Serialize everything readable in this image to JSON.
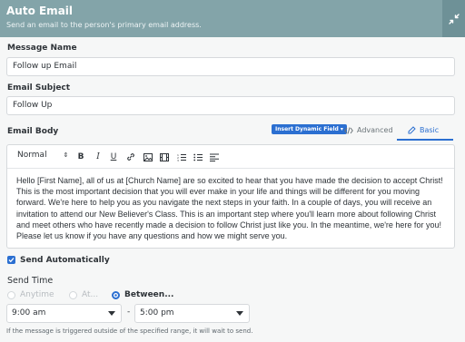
{
  "header": {
    "title": "Auto Email",
    "subtitle": "Send an email to the person's primary email address.",
    "collapse_icon": "collapse-arrows-icon"
  },
  "message_name": {
    "label": "Message Name",
    "value": "Follow up Email"
  },
  "email_subject": {
    "label": "Email Subject",
    "value": "Follow Up"
  },
  "email_body": {
    "label": "Email Body",
    "dynamic_field_button": "Insert Dynamic Field",
    "modes": {
      "advanced": "Advanced",
      "basic": "Basic",
      "active": "basic"
    },
    "toolbar": {
      "format": "Normal",
      "bold": "B",
      "italic": "I",
      "underline": "U"
    },
    "content": "Hello [First Name], all of us at [Church Name] are so excited to hear that you have made the decision to accept Christ! This is the most important decision that you will ever make in your life and things will be different for you moving forward. We're here to help you as you navigate the next steps in your faith. In a couple of days, you will receive an invitation to attend our New Believer's Class. This is an important step where you'll learn more about following Christ and meet others who have recently made a decision to follow Christ just like you. In the meantime, we're here for you! Please let us know if you have any questions and how we might serve you."
  },
  "send_automatically": {
    "label": "Send Automatically",
    "checked": true
  },
  "send_time": {
    "label": "Send Time",
    "options": [
      "Anytime",
      "At...",
      "Between..."
    ],
    "selected": "Between...",
    "start": "9:00 am",
    "separator": "-",
    "end": "5:00 pm",
    "hint": "If the message is triggered outside of the specified range, it will wait to send."
  },
  "colors": {
    "header": "#83a4a9",
    "accent": "#2b6fd1",
    "background": "#f6f7f7"
  }
}
